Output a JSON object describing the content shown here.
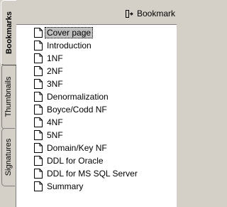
{
  "header": {
    "menu_label": "Bookmark",
    "menu_icon": "bookmark-menu-icon"
  },
  "tabs": [
    {
      "label": "Bookmarks",
      "active": true
    },
    {
      "label": "Thumbnails",
      "active": false
    },
    {
      "label": "Signatures",
      "active": false
    }
  ],
  "bookmarks": [
    {
      "label": "Cover page",
      "selected": true
    },
    {
      "label": "Introduction"
    },
    {
      "label": "1NF"
    },
    {
      "label": "2NF"
    },
    {
      "label": "3NF"
    },
    {
      "label": "Denormalization"
    },
    {
      "label": "Boyce/Codd NF"
    },
    {
      "label": "4NF"
    },
    {
      "label": "5NF"
    },
    {
      "label": "Domain/Key NF"
    },
    {
      "label": "DDL for Oracle"
    },
    {
      "label": "DDL for MS SQL Server"
    },
    {
      "label": "Summary"
    }
  ],
  "bookmark_icon": "document-page-icon"
}
